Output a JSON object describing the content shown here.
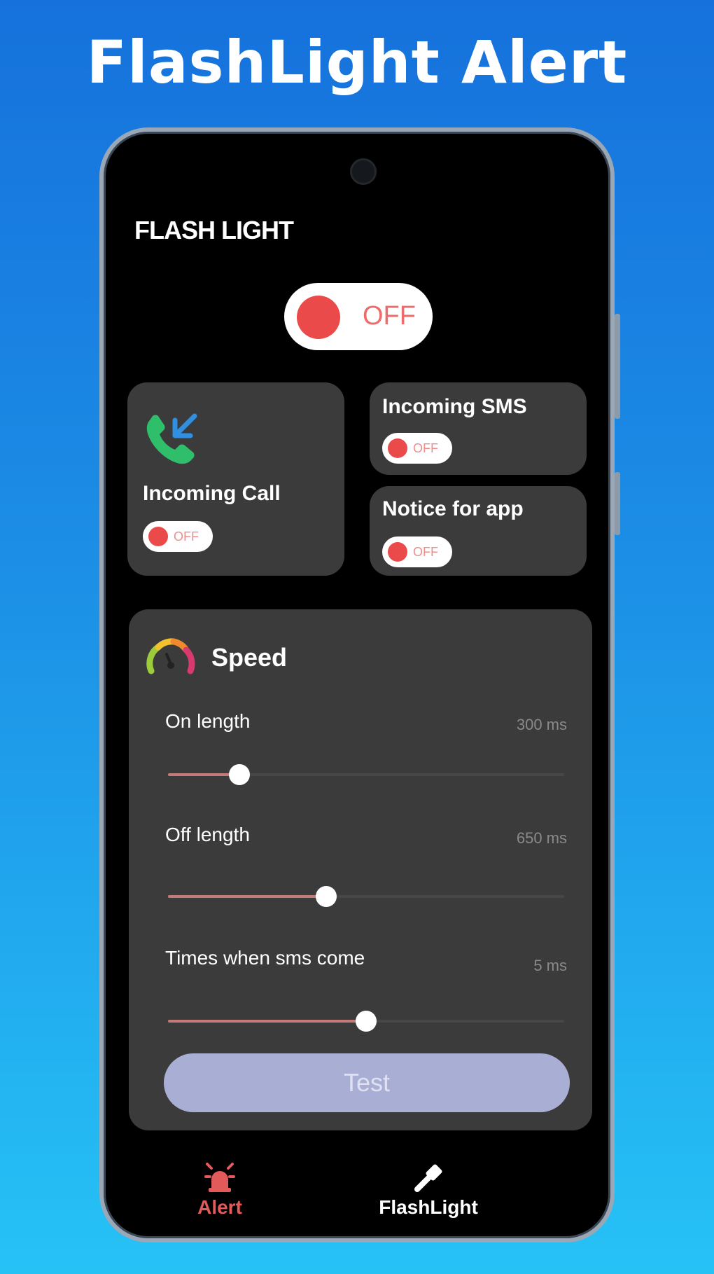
{
  "promo": {
    "title": "FlashLight Alert"
  },
  "app": {
    "title": "FLASH LIGHT",
    "master_toggle": {
      "state": "OFF"
    }
  },
  "cards": {
    "incoming_call": {
      "label": "Incoming Call",
      "toggle": "OFF",
      "icon": "incoming-call-icon"
    },
    "incoming_sms": {
      "label": "Incoming SMS",
      "toggle": "OFF"
    },
    "notice_app": {
      "label": "Notice for app",
      "toggle": "OFF"
    }
  },
  "speed": {
    "title": "Speed",
    "icon": "speedometer-icon",
    "sliders": [
      {
        "label": "On length",
        "value": "300 ms",
        "fraction": 0.18
      },
      {
        "label": "Off length",
        "value": "650 ms",
        "fraction": 0.4
      },
      {
        "label": "Times when sms come",
        "value": "5 ms",
        "fraction": 0.5
      }
    ],
    "test_label": "Test"
  },
  "bottom_nav": [
    {
      "label": "Alert",
      "icon": "alert-bell-icon",
      "active": true
    },
    {
      "label": "FlashLight",
      "icon": "flashlight-icon",
      "active": false
    }
  ],
  "colors": {
    "accent_red": "#ea4a4a",
    "card_bg": "#3b3b3b",
    "test_button": "#a9aed4",
    "active_nav": "#e25a5a"
  }
}
